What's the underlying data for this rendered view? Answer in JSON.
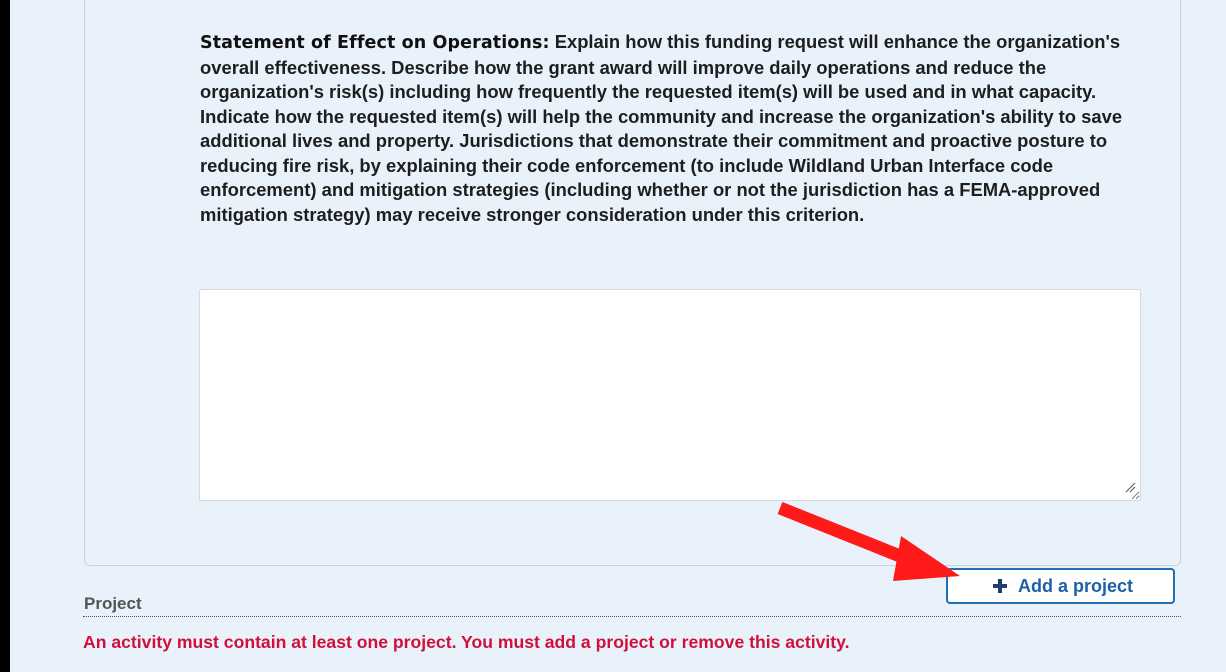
{
  "statement": {
    "label": "Statement of Effect on Operations:",
    "text": " Explain how this funding request will enhance the organization's overall effectiveness. Describe how the grant award will improve daily operations and reduce the organization's risk(s) including how frequently the requested item(s) will be used and in what capacity. Indicate how the requested item(s) will help the community and increase the organization's ability to save additional lives and property. Jurisdictions that demonstrate their commitment and proactive posture to reducing fire risk, by explaining their code enforcement (to include Wildland Urban Interface code enforcement) and mitigation strategies (including whether or not the jurisdiction has a FEMA-approved mitigation strategy) may receive stronger consideration under this criterion.",
    "answer_value": ""
  },
  "actions": {
    "add_project_label": "Add a project",
    "add_project_icon": "plus-icon"
  },
  "project_section": {
    "label": "Project",
    "error": "An activity must contain at least one project. You must add a project or remove this activity."
  },
  "colors": {
    "page_background": "#e9f2fb",
    "button_border": "#1f6fb2",
    "error_text": "#d0103a",
    "annotation_arrow": "#ff1a1a"
  },
  "annotation": {
    "icon": "red-arrow-icon"
  }
}
